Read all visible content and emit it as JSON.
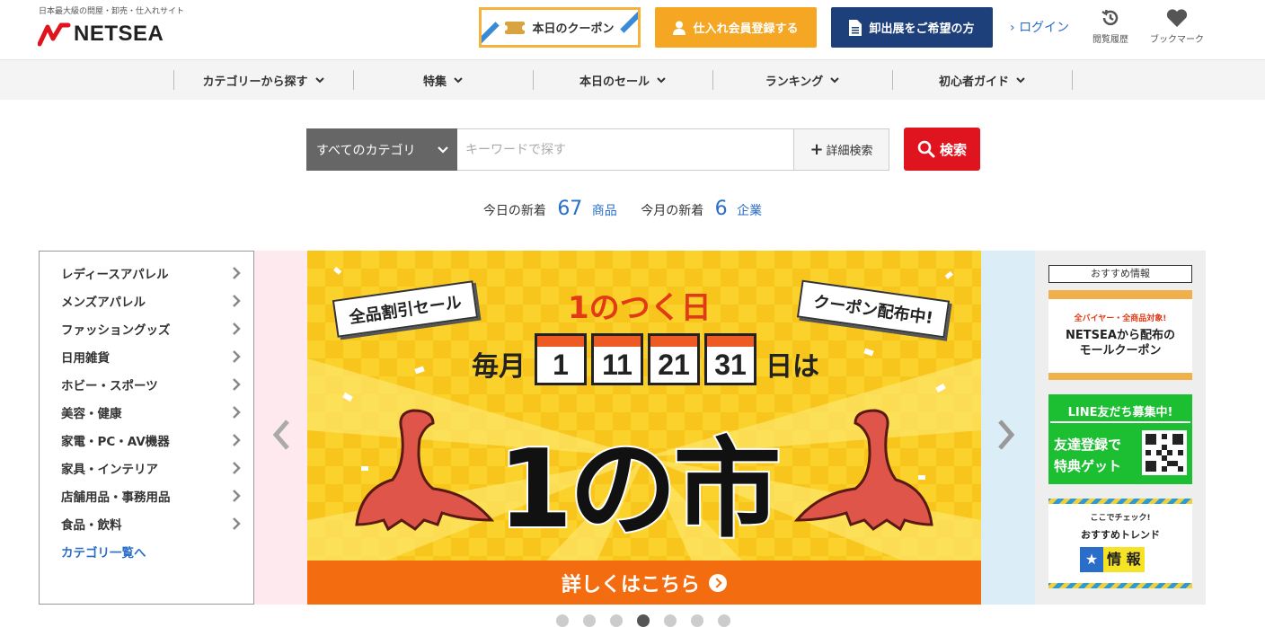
{
  "header": {
    "tagline": "日本最大級の問屋・卸売・仕入れサイト",
    "logo_text": "NETSEA",
    "coupon_label": "本日のクーポン",
    "register_label": "仕入れ会員登録する",
    "wholesale_label": "卸出展をご希望の方",
    "login_label": "ログイン",
    "history_label": "閲覧履歴",
    "bookmark_label": "ブックマーク",
    "colors": {
      "brand_red": "#e0141e",
      "register_orange": "#f5a623",
      "wholesale_navy": "#1d3f7a",
      "link_blue": "#2a6ec9"
    }
  },
  "nav": {
    "items": [
      {
        "label": "カテゴリーから探す"
      },
      {
        "label": "特集"
      },
      {
        "label": "本日のセール"
      },
      {
        "label": "ランキング"
      },
      {
        "label": "初心者ガイド"
      }
    ]
  },
  "search": {
    "category_label": "すべてのカテゴリ",
    "placeholder": "キーワードで探す",
    "value": "",
    "advanced_label": "詳細検索",
    "button_label": "検索"
  },
  "new_arrivals": {
    "today_label": "今日の新着",
    "today_count": "67",
    "today_unit": "商品",
    "month_label": "今月の新着",
    "month_count": "6",
    "month_unit": "企業"
  },
  "categories": {
    "items": [
      {
        "label": "レディースアパレル"
      },
      {
        "label": "メンズアパレル"
      },
      {
        "label": "ファッショングッズ"
      },
      {
        "label": "日用雑貨"
      },
      {
        "label": "ホビー・スポーツ"
      },
      {
        "label": "美容・健康"
      },
      {
        "label": "家電・PC・AV機器"
      },
      {
        "label": "家具・インテリア"
      },
      {
        "label": "店舗用品・事務用品"
      },
      {
        "label": "食品・飲料"
      }
    ],
    "all_link": "カテゴリ一覧へ"
  },
  "banner": {
    "tag_left": "全品割引セール",
    "tag_right": "クーポン配布中!",
    "top_text": "1のつく日",
    "month_prefix": "毎月",
    "days": [
      "1",
      "11",
      "21",
      "31"
    ],
    "day_suffix": "日は",
    "main_text": "1の市",
    "cta": "詳しくはこちら",
    "slide_count": 7,
    "active_slide": 4
  },
  "recommended": {
    "title": "おすすめ情報",
    "card1_sub": "全バイヤー・全商品対象!",
    "card1_line1": "NETSEAから配布の",
    "card1_line2": "モールクーポン",
    "card2_head": "LINE友だち募集中!",
    "card2_line1": "友達登録で",
    "card2_line2": "特典ゲット",
    "card3_sub": "ここでチェック!",
    "card3_main": "おすすめトレンド",
    "card3_star": "★",
    "card3_badge": "情 報"
  }
}
